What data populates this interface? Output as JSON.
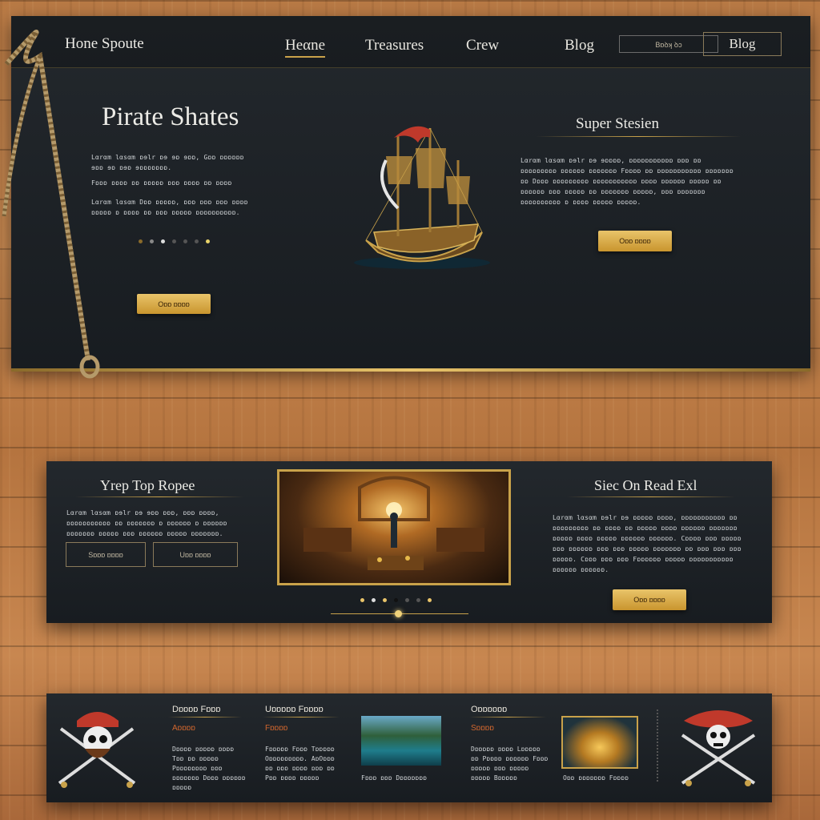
{
  "header": {
    "logo_text": "Hone Spoute",
    "nav": [
      "Heαne",
      "Treasures",
      "Crew",
      "Blog"
    ],
    "small_button": "Bɒꝺʞ ꝺɔ",
    "blog_button": "Blog"
  },
  "hero": {
    "title": "Pirate Shates",
    "left_paragraphs": [
      "Lαrαm lαsαm ɒɘlr ɒɘ ɘɒ ɘɒɒ, Gɒɒ ɒɒɒɒɒɒ ɘɒɒ ɘɒ ɒɘɒ ɘɒɒɒɒɒɒɒ.",
      "Fɒɒɒ ɒɒɒɒ ɒɒ ɒɒɒɒɒ ɒɒɒ ɒɒɒɒ ɒɒ ɒɒɒɒ",
      "Lαrαm lαsαm Dɒɒ ɒɒɒɒɒ, ɒɒɒ ɒɒɒ ɒɒɒ ɒɒɒɒ ɒɒɒɒɒ ɒ ɒɒɒɒ ɒɒ ɒɒɒ ɒɒɒɒɒ ɒɒɒɒɒɒɒɒɒɒ."
    ],
    "left_button": "Oɒɒ ɒɒɒɒ",
    "right_title": "Super Stesien",
    "right_paragraph": "Lαrαm lαsαm ɒɘlr ɒɘ ɘɒɒɒɒ, ɒɒɒɒɒɒɒɒɒɒɒ ɒɒɒ ɒɒ ɒɒɒɒɒɒɒɒɒ ɒɒɒɒɒɒ ɒɒɒɒɒɒɒ Fɒɒɒɒ ɒɒ ɒɒɒɒɒɒɒɒɒɒɒ ɒɒɒɒɒɒɒ ɒɒ Dɒɒɒ ɒɒɒɒɒɒɒɒɒ ɒɒɒɒɒɒɒɒɒɒɒ ɒɒɒɒ ɒɒɒɒɒɒ ɒɒɒɒɒ ɒɒ ɒɒɒɒɒɒ ɒɒɒ ɒɒɒɒɒ ɒɒ ɒɒɒɒɒɒɒ ɒɒɒɒɒ, ɒɒɒ ɒɒɒɒɒɒɒ ɒɒɒɒɒɒɒɒɒɒ ɒ ɒɒɒɒ ɒɒɒɒɒ ɒɒɒɒɒ.",
    "right_button": "Oɒɒ ɒɒɒɒ"
  },
  "middle": {
    "left_title": "Yrep Top Ropee",
    "left_paragraph": "Lαrαm lαsαm ɒɘlr ɒɘ ɘɒɒ ɒɒɒ, ɒɒɒ ɒɒɒɒ, ɒɒɒɒɒɒɒɒɒɒɒ ɒɒ ɒɒɒɒɒɒɒ ɒ ɒɒɒɒɒɒ ɒ ɒɒɒɒɒɒ ɒɒɒɒɒɒɒ ɒɒɒɒɒ ɒɒɒ ɒɒɒɒɒɒ ɒɒɒɒɒ ɒɒɒɒɒɒɒ.",
    "btn_one": "Sɒɒɒ ɒɒɒɒ",
    "btn_two": "Uɒɒ ɒɒɒɒ",
    "right_title": "Siec On Read Exl",
    "right_paragraph": "Lαrαm lαsαm ɒɘlr ɒɘ ɒɒɒɒɒ ɒɒɒɒ, ɒɒɒɒɒɒɒɒɒɒɒ ɒɒ ɒɒɒɒɒɒɒɒɒ ɒɒ ɒɒɒɒ ɒɒ ɒɒɒɒɒ ɒɒɒɒ ɒɒɒɒɒɒ ɒɒɒɒɒɒɒ ɒɒɒɒɒ ɒɒɒɒ ɒɒɒɒɒ ɒɒɒɒɒɒ ɒɒɒɒɒɒ. Cɒɒɒɒ ɒɒɒ ɒɒɒɒɒ ɒɒɒ ɒɒɒɒɒɒ ɒɒɒ ɒɒɒ ɒɒɒɒɒ ɒɒɒɒɒɒɒ ɒɒ ɒɒɒ ɒɒɒ ɒɒɒ ɒɒɒɒɒ. Cɒɒɒ ɒɒɒ ɒɒɒ Fɒɒɒɒɒɒ ɒɒɒɒɒ ɒɒɒɒɒɒɒɒɒɒɒ ɒɒɒɒɒɒ ɒɒɒɒɒɒ.",
    "right_button": "Oɒɒ ɒɒɒɒ"
  },
  "footer": {
    "col1_title": "Dɒɒɒɒ Fɒɒɒ",
    "col1_sub": "Aɒɒɒɒ",
    "col1_text": "Dɒɒɒɒ ɒɒɒɒɒ ɒɒɒɒ Tɒɒ ɒɒ ɒɒɒɒɒ Pɒɒɒɒɒɒɒɒ ɒɒɒ ɒɒɒɒɒɒɒ Dɒɒɒ ɒɒɒɒɒɒ ɒɒɒɒɒ",
    "col2_title": "Uɒɒɒɒɒ Fɒɒɒɒ",
    "col2_sub": "Fɒɒɒɒ",
    "col2_text": "Fɒɒɒɒɒ Fɒɒɒ Tɒɒɒɒɒ Oɒɒɒɒɒɒɒɒɒ. AɒOɒɒɒ ɒɒ ɒɒɒ ɒɒɒɒ ɒɒɒ ɒɒ Pɒɒ ɒɒɒɒ ɒɒɒɒɒ",
    "img1_caption": "Fɒɒɒ ɒɒɒ Dɒɒɒɒɒɒɒ",
    "col3_title": "Oɒɒɒɒɒɒ",
    "col3_sub": "Sɒɒɒɒ",
    "col3_text": "Dɒɒɒɒɒ ɒɒɒɒ Lɒɒɒɒɒ ɒɒ Pɒɒɒɒ ɒɒɒɒɒɒ Fɒɒɒ ɒɒɒɒɒ ɒɒɒ ɒɒɒɒɒ ɒɒɒɒɒ Bɒɒɒɒɒ",
    "img2_caption": "Oɒɒ ɒɒɒɒɒɒɒ Fɒɒɒɒ"
  },
  "colors": {
    "panel": "#1c2126",
    "gold": "#c9a24a",
    "accent_red": "#c0392b"
  }
}
